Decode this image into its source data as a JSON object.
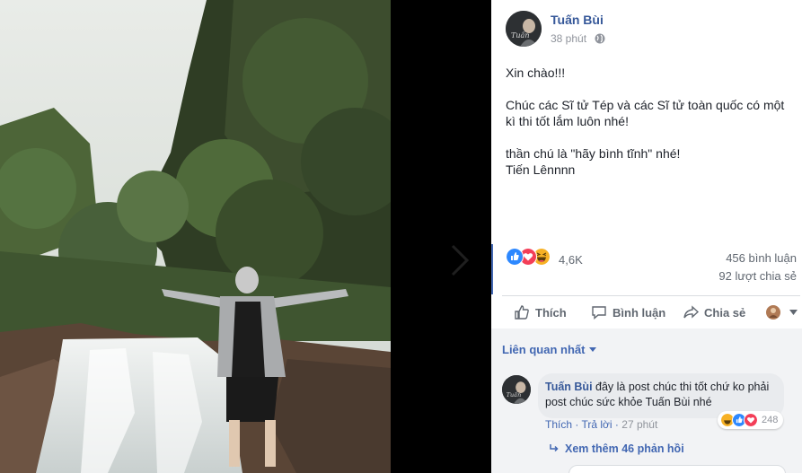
{
  "post": {
    "author": "Tuấn Bùi",
    "time": "38 phút",
    "text": {
      "greeting": "Xin chào!!!",
      "wish": "Chúc các Sĩ tử Tép và các Sĩ tử toàn quốc có một kì thi tốt lắm luôn nhé!",
      "mantra": "thần chú là \"hãy bình tĩnh\" nhé!",
      "signoff": "Tiến Lênnnn"
    }
  },
  "stats": {
    "reactions_count": "4,6K",
    "comments": "456 bình luận",
    "shares": "92 lượt chia sẻ",
    "reaction_types": [
      "like",
      "love",
      "haha"
    ]
  },
  "actions": {
    "like": "Thích",
    "comment": "Bình luận",
    "share": "Chia sẻ"
  },
  "comments": {
    "sort_label": "Liên quan nhất",
    "items": [
      {
        "author": "Tuấn Bùi",
        "text": "đây là post chúc thi tốt chứ ko phải post chúc sức khỏe Tuấn Bùi nhé",
        "like_label": "Thích",
        "reply_label": "Trả lời",
        "time": "27 phút",
        "reaction_count": "248"
      }
    ],
    "more_replies": "Xem thêm 46 phản hồi"
  },
  "colors": {
    "brand": "#4267b2",
    "name": "#365899",
    "muted": "#90949c",
    "like": "#2d88ff",
    "love": "#f33e58",
    "haha": "#f7b125"
  }
}
